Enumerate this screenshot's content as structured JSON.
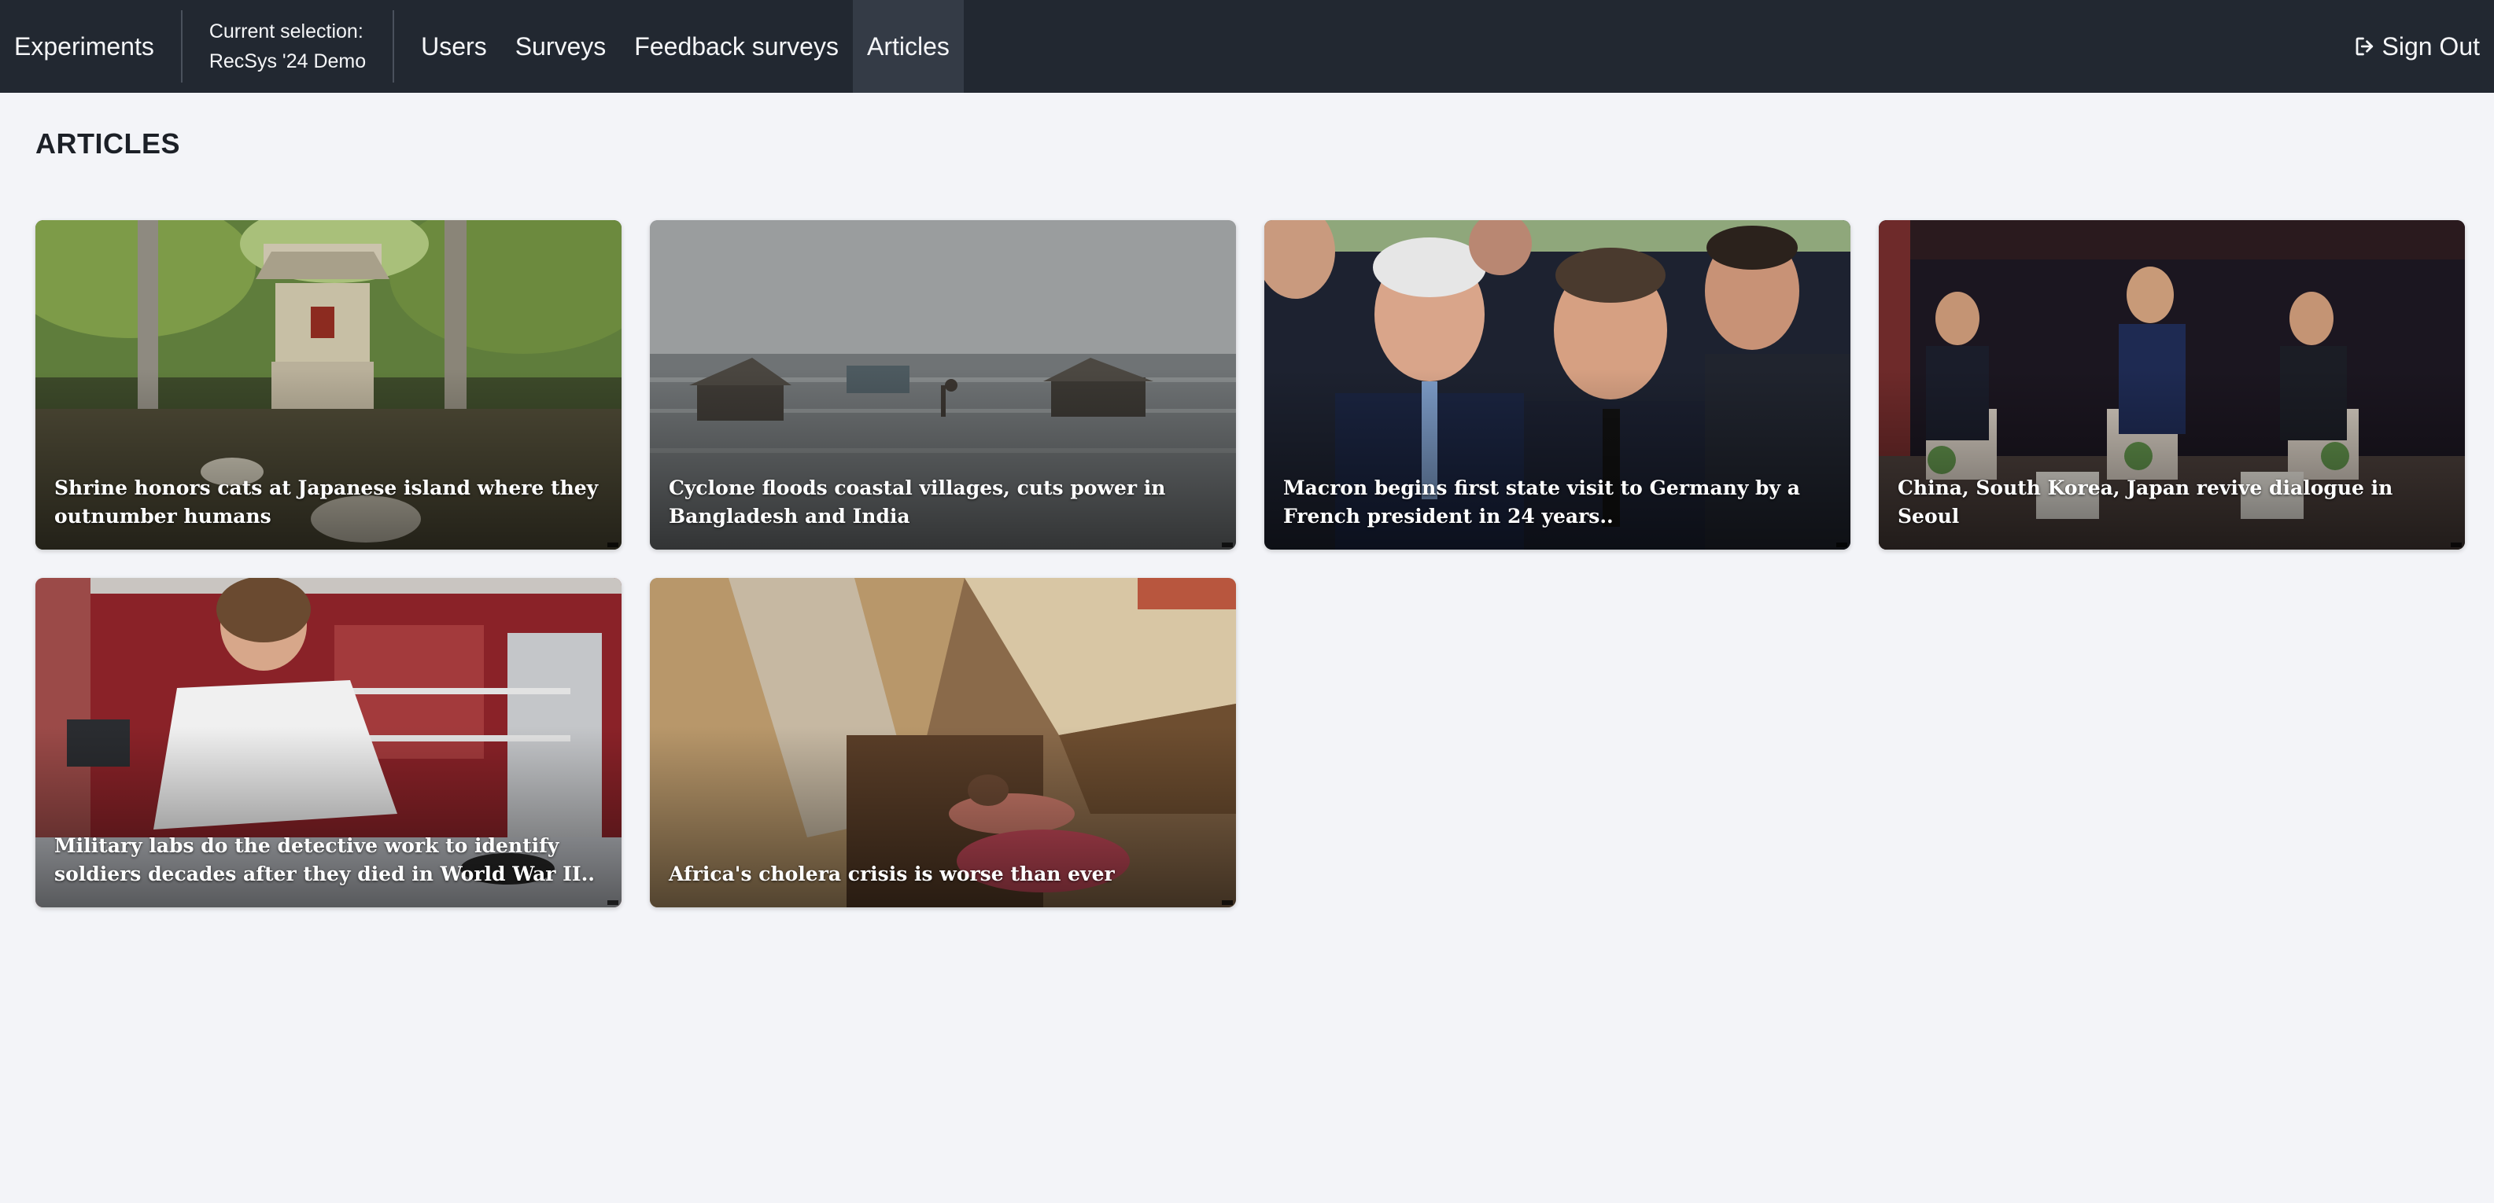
{
  "navbar": {
    "brand": "Experiments",
    "selection_label": "Current selection:",
    "selection_value": "RecSys '24 Demo",
    "links": [
      {
        "label": "Users",
        "active": false
      },
      {
        "label": "Surveys",
        "active": false
      },
      {
        "label": "Feedback surveys",
        "active": false
      },
      {
        "label": "Articles",
        "active": true
      }
    ],
    "signout_label": "Sign Out",
    "signout_icon": "sign-out-icon"
  },
  "page": {
    "title": "ARTICLES"
  },
  "articles": [
    {
      "title": "Shrine honors cats at Japanese island where they outnumber humans"
    },
    {
      "title": "Cyclone floods coastal villages, cuts power in Bangladesh and India"
    },
    {
      "title": "Macron begins first state visit to Germany by a French president in 24 years.."
    },
    {
      "title": "China, South Korea, Japan revive dialogue in Seoul"
    },
    {
      "title": "Military labs do the detective work to identify soldiers decades after they died in World War II.."
    },
    {
      "title": "Africa's cholera crisis is worse than ever"
    }
  ],
  "colors": {
    "navbar_bg": "#222831",
    "active_link_bg": "#343b46",
    "page_bg": "#f3f4f8"
  }
}
